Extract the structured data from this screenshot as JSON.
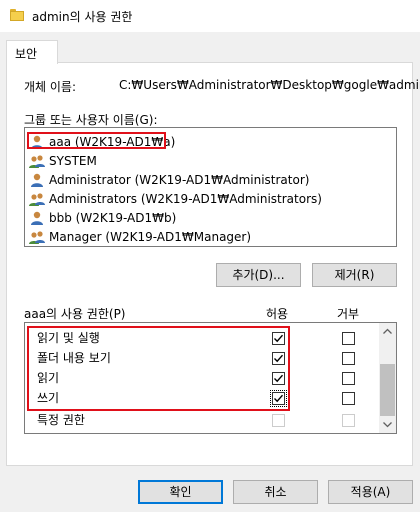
{
  "window": {
    "title": "admin의 사용 권한",
    "folder_icon": "folder-icon"
  },
  "tabs": [
    {
      "label": "보안",
      "active": true
    }
  ],
  "object": {
    "label": "개체 이름:",
    "value": "C:₩Users₩Administrator₩Desktop₩gogle₩admin"
  },
  "groups": {
    "label": "그룹 또는 사용자 이름(G):",
    "items": [
      {
        "name": "aaa (W2K19-AD1₩a)",
        "icon": "user-icon",
        "selected": true
      },
      {
        "name": "SYSTEM",
        "icon": "group-icon"
      },
      {
        "name": "Administrator (W2K19-AD1₩Administrator)",
        "icon": "user-icon"
      },
      {
        "name": "Administrators (W2K19-AD1₩Administrators)",
        "icon": "group-icon"
      },
      {
        "name": "bbb (W2K19-AD1₩b)",
        "icon": "user-icon"
      },
      {
        "name": "Manager (W2K19-AD1₩Manager)",
        "icon": "group-icon"
      }
    ]
  },
  "buttons": {
    "add": "추가(D)...",
    "remove": "제거(R)",
    "ok": "확인",
    "cancel": "취소",
    "apply": "적용(A)"
  },
  "permissions": {
    "label": "aaa의 사용 권한(P)",
    "allow_header": "허용",
    "deny_header": "거부",
    "rows": [
      {
        "name": "읽기 및 실행",
        "allow": true,
        "deny": false
      },
      {
        "name": "폴더 내용 보기",
        "allow": true,
        "deny": false
      },
      {
        "name": "읽기",
        "allow": true,
        "deny": false
      },
      {
        "name": "쓰기",
        "allow": true,
        "deny": false,
        "focused": true
      },
      {
        "name": "특정 권한",
        "allow": false,
        "deny": false,
        "disabled": true
      }
    ]
  },
  "colors": {
    "highlight": "#e0101a",
    "primary_border": "#0078d7"
  }
}
